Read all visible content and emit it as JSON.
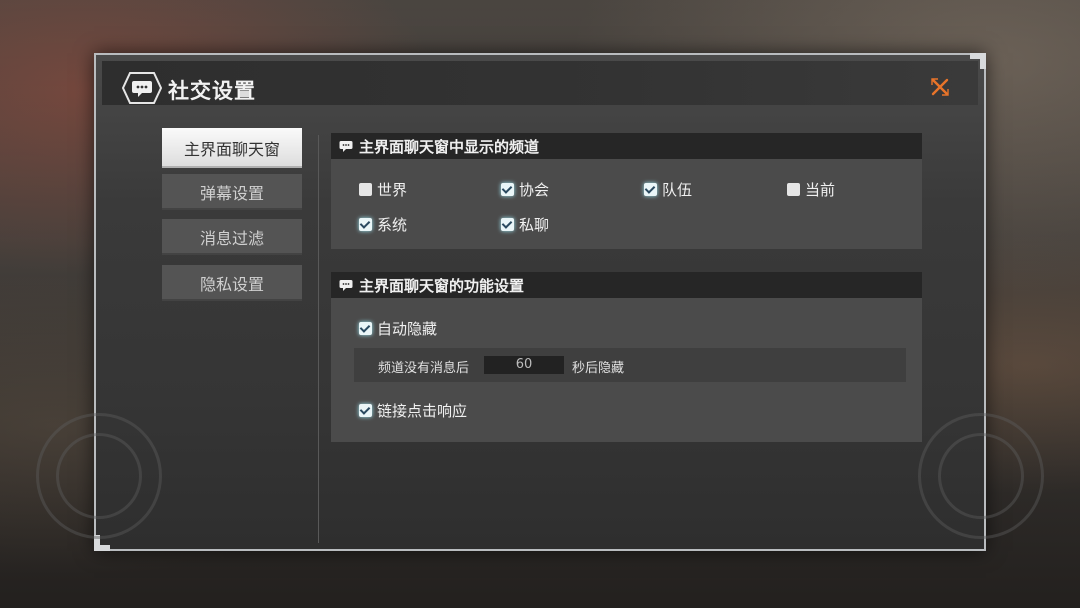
{
  "window": {
    "title": "社交设置"
  },
  "colors": {
    "accent_close": "#e8742a",
    "check_glow": "#9fe6f2"
  },
  "icons": {
    "title": "chat-bubble-icon",
    "close": "close-icon",
    "section": "chat-bubble-icon"
  },
  "sidebar": {
    "items": [
      {
        "label": "主界面聊天窗",
        "active": true
      },
      {
        "label": "弹幕设置",
        "active": false
      },
      {
        "label": "消息过滤",
        "active": false
      },
      {
        "label": "隐私设置",
        "active": false
      }
    ]
  },
  "channels": {
    "header": "主界面聊天窗中显示的频道",
    "options": [
      {
        "label": "世界",
        "checked": false
      },
      {
        "label": "协会",
        "checked": true
      },
      {
        "label": "队伍",
        "checked": true
      },
      {
        "label": "当前",
        "checked": false
      },
      {
        "label": "系统",
        "checked": true
      },
      {
        "label": "私聊",
        "checked": true
      }
    ]
  },
  "functions": {
    "header": "主界面聊天窗的功能设置",
    "auto_hide": {
      "label": "自动隐藏",
      "checked": true
    },
    "hide_prefix": "频道没有消息后",
    "hide_seconds": "60",
    "hide_suffix": "秒后隐藏",
    "link_click": {
      "label": "链接点击响应",
      "checked": true
    }
  }
}
